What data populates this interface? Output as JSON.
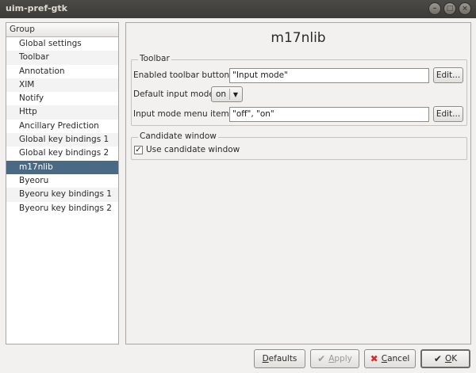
{
  "window": {
    "title": "uim-pref-gtk"
  },
  "wm_buttons": [
    "–",
    "□",
    "×"
  ],
  "group": {
    "header": "Group",
    "items": [
      "Global settings",
      "Toolbar",
      "Annotation",
      "XIM",
      "Notify",
      "Http",
      "Ancillary Prediction",
      "Global key bindings 1",
      "Global key bindings 2",
      "m17nlib",
      "Byeoru",
      "Byeoru key bindings 1",
      "Byeoru key bindings 2"
    ],
    "selected": "m17nlib"
  },
  "page": {
    "title": "m17nlib",
    "toolbar_frame": {
      "label": "Toolbar",
      "enabled_buttons": {
        "label": "Enabled toolbar buttons",
        "value": "\"Input mode\"",
        "edit": "Edit..."
      },
      "default_mode": {
        "label": "Default input mode",
        "value": "on"
      },
      "menu_items": {
        "label": "Input mode menu items",
        "value": "\"off\", \"on\"",
        "edit": "Edit..."
      }
    },
    "candidate_frame": {
      "label": "Candidate window",
      "use_candidate": {
        "label": "Use candidate window",
        "checked": true
      }
    }
  },
  "buttons": {
    "defaults": {
      "label": "Defaults",
      "mnemonic": "D",
      "rest": "efaults"
    },
    "apply": {
      "label": "Apply",
      "mnemonic": "A",
      "rest": "pply",
      "enabled": false
    },
    "cancel": {
      "label": "Cancel",
      "mnemonic": "C",
      "rest": "ancel"
    },
    "ok": {
      "label": "OK",
      "mnemonic": "O",
      "rest": "K"
    }
  },
  "colors": {
    "selection": "#4a6984",
    "titlebar": "#3c3b37",
    "cancel_icon": "#d0312d"
  }
}
